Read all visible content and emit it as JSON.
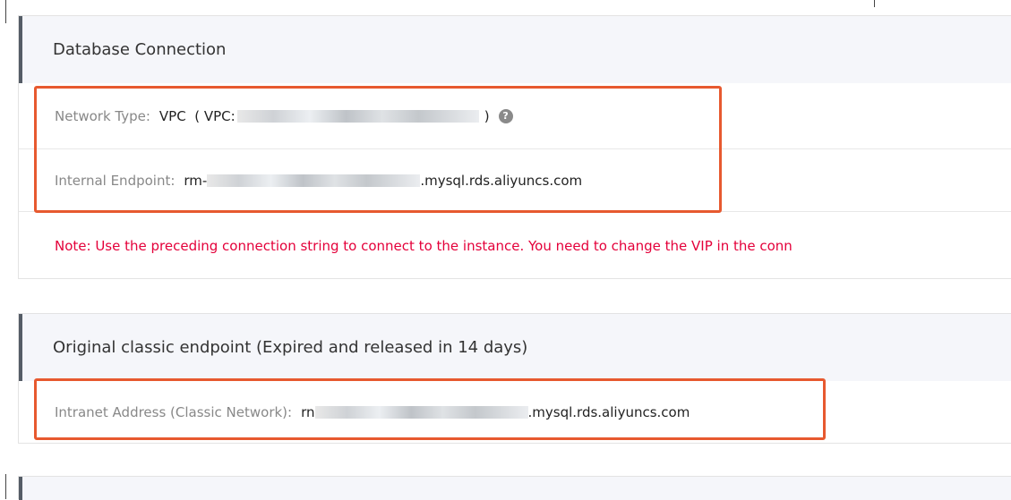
{
  "db_connection": {
    "title": "Database Connection",
    "network_type_label": "Network Type:",
    "network_type_prefix": "VPC  ( VPC:",
    "network_type_suffix": ")",
    "help_icon": "question-circle-icon",
    "internal_endpoint_label": "Internal Endpoint:",
    "internal_endpoint_prefix": "rm-",
    "internal_endpoint_suffix": ".mysql.rds.aliyuncs.com",
    "note": "Note: Use the preceding connection string to connect to the instance. You need to change the VIP in the conn"
  },
  "classic": {
    "title": "Original classic endpoint (Expired and released in 14 days)",
    "intranet_label": "Intranet Address (Classic Network):",
    "intranet_prefix": "rn",
    "intranet_suffix": ".mysql.rds.aliyuncs.com"
  },
  "colors": {
    "highlight": "#e7592f",
    "note_text": "#e4003a",
    "header_bg": "#f5f6fa"
  }
}
